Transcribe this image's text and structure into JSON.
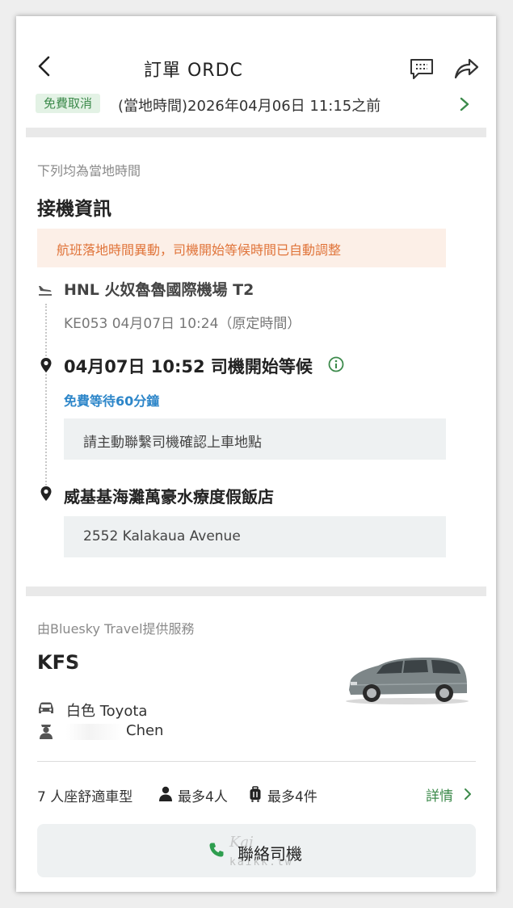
{
  "header": {
    "title": "訂單 ORDC",
    "cancel_badge": "免費取消",
    "cancel_deadline": "(當地時間)2026年04月06日 11:15之前"
  },
  "pickup": {
    "local_time_note": "下列均為當地時間",
    "title": "接機資訊",
    "alert": "航班落地時間異動，司機開始等候時間已自動調整",
    "airport": "HNL 火奴魯魯國際機場 T2",
    "flight_info": "KE053  04月07日 10:24（原定時間）",
    "driver_wait": "04月07日 10:52 司機開始等候",
    "free_wait": "免費等待60分鐘",
    "contact_note": "請主動聯繫司機確認上車地點",
    "destination": "威基基海灘萬豪水療度假飯店",
    "destination_address": "2552 Kalakaua Avenue"
  },
  "service": {
    "provider": "由Bluesky Travel提供服務",
    "plate": "KFS",
    "car": "白色  Toyota",
    "driver": "Chen",
    "seats": "7 人座舒適車型",
    "max_passengers": "最多4人",
    "max_luggage": "最多4件",
    "details_label": "詳情",
    "contact_button": "聯絡司機"
  },
  "watermark": {
    "script": "Kai",
    "text": "kaikk.tw"
  },
  "colors": {
    "accent_green": "#3c8a4b",
    "badge_bg": "#e3f2e5",
    "alert_orange": "#e0743a",
    "alert_bg": "#fcefe7",
    "link_blue": "#2d86c9",
    "gray_box": "#eef1f2"
  },
  "icons": [
    "chevron-left-icon",
    "chat-icon",
    "share-icon",
    "chevron-right-icon",
    "plane-landing-icon",
    "pin-icon",
    "info-icon",
    "car-icon",
    "driver-icon",
    "person-icon",
    "luggage-icon",
    "phone-icon"
  ]
}
